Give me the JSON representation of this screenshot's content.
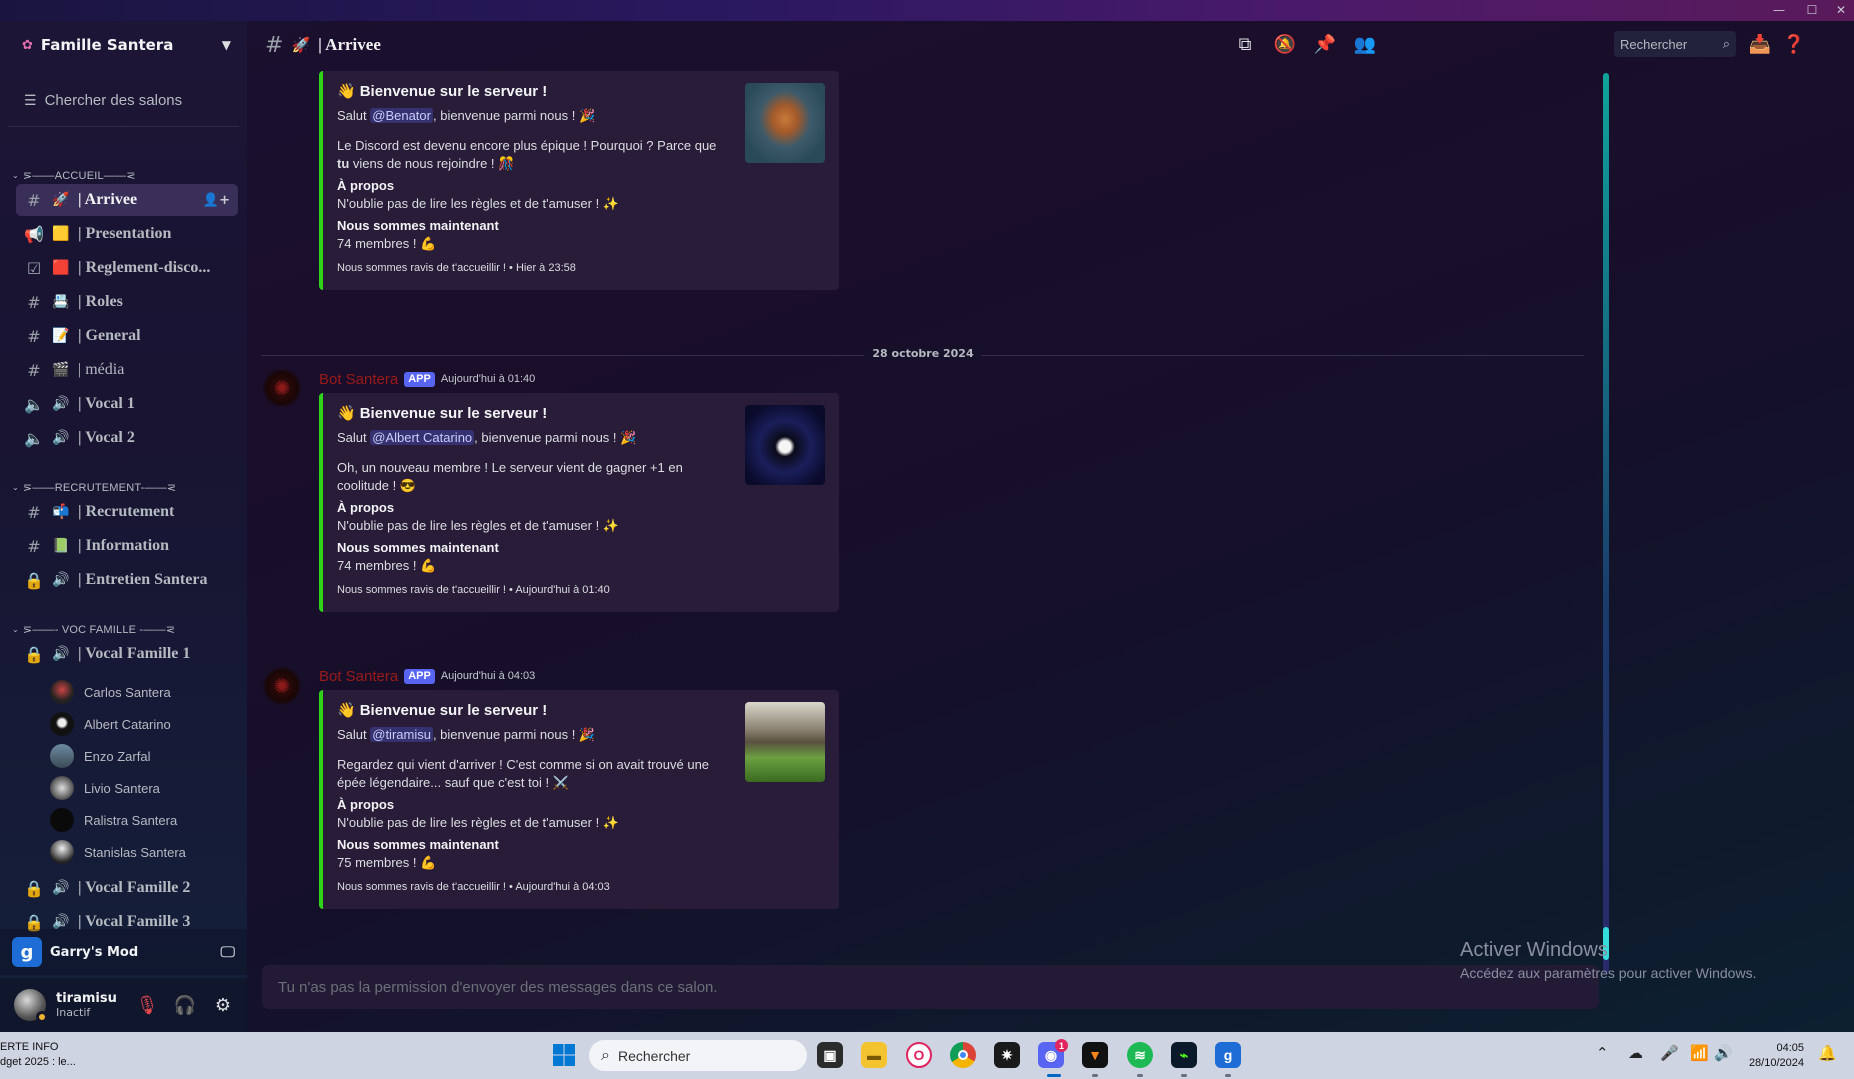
{
  "window": {
    "controls": [
      "—",
      "☐",
      "✕"
    ]
  },
  "server": {
    "name": "Famille Santera"
  },
  "sidebar": {
    "search_label": "Chercher des salons",
    "categories": [
      {
        "label": "⋝——ACCUEIL——⋜"
      },
      {
        "label": "⋝——RECRUTEMENT-——⋜"
      },
      {
        "label": "⋝——- VOC FAMILLE -——⋜"
      }
    ],
    "channels": [
      {
        "label": "| Arrivee",
        "emoji": "🚀"
      },
      {
        "label": "| Presentation",
        "emoji": "🟨"
      },
      {
        "label": "| Reglement-disco...",
        "emoji": "🟥"
      },
      {
        "label": "| Roles",
        "emoji": "📇"
      },
      {
        "label": "| General",
        "emoji": "📝"
      },
      {
        "label": "| média",
        "emoji": "🎬"
      },
      {
        "label": "| Vocal 1",
        "emoji": "🔊"
      },
      {
        "label": "| Vocal 2",
        "emoji": "🔊"
      },
      {
        "label": "| Recrutement",
        "emoji": "📬"
      },
      {
        "label": "| Information",
        "emoji": "📗"
      },
      {
        "label": "| Entretien Santera",
        "emoji": "🔊"
      },
      {
        "label": "| Vocal Famille 1",
        "emoji": "🔊"
      },
      {
        "label": "| Vocal Famille 2",
        "emoji": "🔊"
      },
      {
        "label": "| Vocal Famille 3",
        "emoji": "🔊"
      }
    ],
    "voice_users": [
      "Carlos Santera",
      "Albert Catarino",
      "Enzo Zarfal",
      "Livio Santera",
      "Ralistra Santera",
      "Stanislas Santera"
    ]
  },
  "activity": {
    "name": "Garry's Mod"
  },
  "user": {
    "name": "tiramisu",
    "status": "Inactif"
  },
  "header": {
    "title": "| Arrivee",
    "search_placeholder": "Rechercher"
  },
  "messages": [
    {
      "embed": {
        "title": "Bienvenue sur le serveur !",
        "greeting_pre": "Salut ",
        "mention": "@Benator",
        "greeting_post": ", bienvenue parmi nous ! 🎉",
        "desc_pre": "Le Discord est devenu encore plus épique ! Pourquoi ? Parce que ",
        "desc_bold": "tu",
        "desc_post": " viens de nous rejoindre ! 🎊",
        "about_title": "À propos",
        "about_text": "N'oublie pas de lire les règles et de t'amuser ! ✨",
        "members_title": "Nous sommes maintenant",
        "members_text": "74 membres ! 💪",
        "footer": "Nous sommes ravis de t'accueillir ! • Hier à 23:58"
      }
    },
    {
      "author": "Bot Santera",
      "tag": "APP",
      "time": "Aujourd'hui à 01:40",
      "embed": {
        "title": "Bienvenue sur le serveur !",
        "greeting_pre": "Salut ",
        "mention": "@Albert Catarino",
        "greeting_post": ", bienvenue parmi nous ! 🎉",
        "desc": "Oh, un nouveau membre ! Le serveur vient de gagner +1 en coolitude ! 😎",
        "about_title": "À propos",
        "about_text": "N'oublie pas de lire les règles et de t'amuser ! ✨",
        "members_title": "Nous sommes maintenant",
        "members_text": "74 membres ! 💪",
        "footer": "Nous sommes ravis de t'accueillir ! • Aujourd'hui à 01:40"
      }
    },
    {
      "author": "Bot Santera",
      "tag": "APP",
      "time": "Aujourd'hui à 04:03",
      "embed": {
        "title": "Bienvenue sur le serveur !",
        "greeting_pre": "Salut ",
        "mention": "@tiramisu",
        "greeting_post": ", bienvenue parmi nous ! 🎉",
        "desc": "Regardez qui vient d'arriver ! C'est comme si on avait trouvé une épée légendaire... sauf que c'est toi ! ⚔️",
        "about_title": "À propos",
        "about_text": "N'oublie pas de lire les règles et de t'amuser ! ✨",
        "members_title": "Nous sommes maintenant",
        "members_text": "75 membres ! 💪",
        "footer": "Nous sommes ravis de t'accueillir ! • Aujourd'hui à 04:03"
      }
    }
  ],
  "date_divider": "28 octobre 2024",
  "composer": {
    "placeholder": "Tu n'as pas la permission d'envoyer des messages dans ce salon."
  },
  "watermark": {
    "line1": "Activer Windows",
    "line2": "Accédez aux paramètres pour activer Windows."
  },
  "taskbar": {
    "news_line1": "ERTE INFO",
    "news_line2": "dget 2025 : le...",
    "search_placeholder": "Rechercher",
    "discord_badge": "1",
    "time": "04:05",
    "date": "28/10/2024"
  },
  "colors": {
    "embed_bar": "#2fd41a",
    "bot_author": "#9b1a1a",
    "app_tag": "#5865f2",
    "mention": "#c9cdfb"
  }
}
